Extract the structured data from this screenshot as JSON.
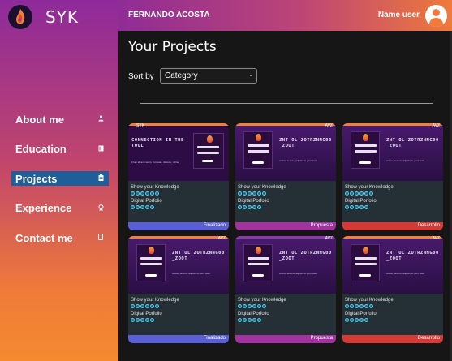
{
  "brand": {
    "name": "SYK"
  },
  "header": {
    "user_full_name": "FERNANDO ACOSTA",
    "name_user_label": "Name user"
  },
  "nav": {
    "items": [
      {
        "label": "About me",
        "icon": "person-icon",
        "active": false
      },
      {
        "label": "Education",
        "icon": "book-icon",
        "active": false
      },
      {
        "label": "Projects",
        "icon": "clipboard-icon",
        "active": true
      },
      {
        "label": "Experience",
        "icon": "award-icon",
        "active": false
      },
      {
        "label": "Contact me",
        "icon": "phone-icon",
        "active": false
      }
    ]
  },
  "main": {
    "title": "Your Projects",
    "sort_label": "Sort by",
    "sort_value": "Category",
    "sort_caret": "-"
  },
  "cards": [
    {
      "tag": "SYK",
      "thumb_title": "CONNECTION IN THE TOOL_",
      "thumb_sub": "From idea to team, innovate, discuss, refine",
      "skill1": "Show your Knowledge",
      "skill2": "Digital Porfolio",
      "status": "Finalizado",
      "status_color": "#5b5fd6"
    },
    {
      "tag": "AVZ",
      "thumb_title": "ZNT OL ZOTRZNNG00 _ZOOT",
      "thumb_sub": "online, secure, adjusts to your work",
      "skill1": "Show your Knowledge",
      "skill2": "Digital Porfolio",
      "status": "Propuesta",
      "status_color": "#a1339e"
    },
    {
      "tag": "AVZ",
      "thumb_title": "ZNT OL ZOTRZNNG00 _ZOOT",
      "thumb_sub": "online, secure, adjusts to your work",
      "skill1": "Show your Knowledge",
      "skill2": "Digital Porfolio",
      "status": "Desarrollo",
      "status_color": "#d43a36"
    },
    {
      "tag": "AVZ",
      "thumb_title": "ZNT OL ZOTRZNNG00 _ZOOT",
      "thumb_sub": "online, secure, adjusts to your work",
      "skill1": "Show your Knowledge",
      "skill2": "Digital Porfolio",
      "status": "Finalizado",
      "status_color": "#5b5fd6"
    },
    {
      "tag": "AVZ",
      "thumb_title": "ZNT OL ZOTRZNNG00 _ZOOT",
      "thumb_sub": "online, secure, adjusts to your work",
      "skill1": "Show your Knowledge",
      "skill2": "Digital Porfolio",
      "status": "Propuesta",
      "status_color": "#a1339e"
    },
    {
      "tag": "AVZ",
      "thumb_title": "ZNT OL ZOTRZNNG00 _ZOOT",
      "thumb_sub": "online, secure, adjusts to your work",
      "skill1": "Show your Knowledge",
      "skill2": "Digital Porfolio",
      "status": "Desarrollo",
      "status_color": "#d43a36"
    }
  ],
  "colors": {
    "active_nav": "#1e5f99",
    "accent_orange": "#ef7a3b"
  }
}
